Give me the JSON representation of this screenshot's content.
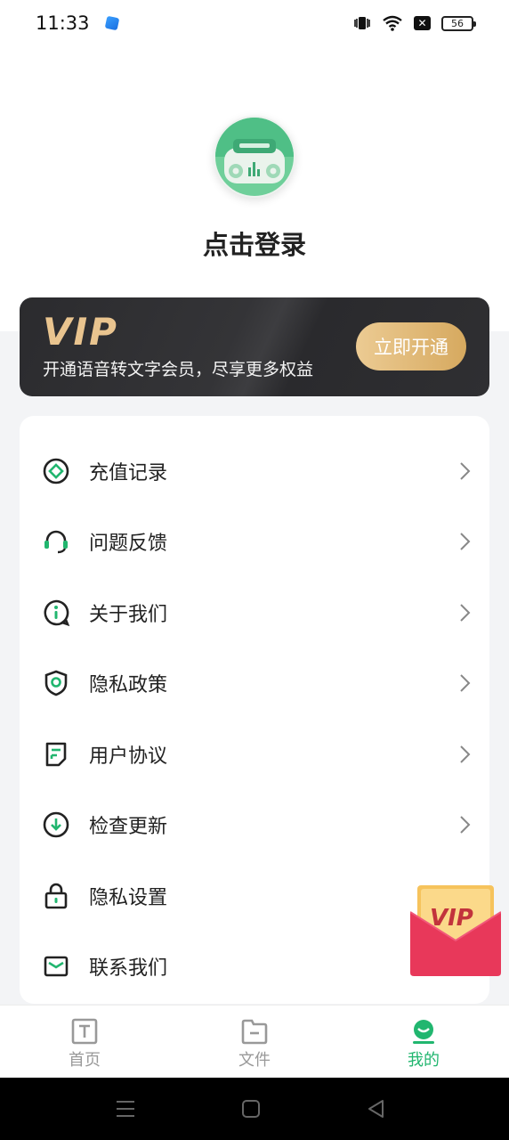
{
  "status_bar": {
    "time": "11:33",
    "battery": "56",
    "icons": [
      "vibrate-icon",
      "wifi-icon",
      "x-box-icon",
      "battery-icon"
    ]
  },
  "profile": {
    "avatar_icon": "radio-avatar-icon",
    "login_text": "点击登录"
  },
  "vip_banner": {
    "logo": "VIP",
    "subtitle": "开通语音转文字会员，尽享更多权益",
    "button_label": "立即开通",
    "accent": "#e9c48f"
  },
  "menu": {
    "items": [
      {
        "label": "充值记录",
        "icon": "recharge-record-icon",
        "chevron": true
      },
      {
        "label": "问题反馈",
        "icon": "headset-feedback-icon",
        "chevron": true
      },
      {
        "label": "关于我们",
        "icon": "info-bubble-icon",
        "chevron": true
      },
      {
        "label": "隐私政策",
        "icon": "shield-icon",
        "chevron": true
      },
      {
        "label": "用户协议",
        "icon": "document-icon",
        "chevron": true
      },
      {
        "label": "检查更新",
        "icon": "download-circle-icon",
        "chevron": true
      },
      {
        "label": "隐私设置",
        "icon": "lock-icon",
        "chevron": false
      },
      {
        "label": "联系我们",
        "icon": "mail-icon",
        "chevron": false
      }
    ]
  },
  "floating_vip": {
    "label": "VIP"
  },
  "bottom_nav": {
    "tabs": [
      {
        "label": "首页",
        "icon": "text-t-icon",
        "active": false
      },
      {
        "label": "文件",
        "icon": "folder-icon",
        "active": false
      },
      {
        "label": "我的",
        "icon": "user-face-icon",
        "active": true
      }
    ],
    "active_color": "#21b66f"
  }
}
